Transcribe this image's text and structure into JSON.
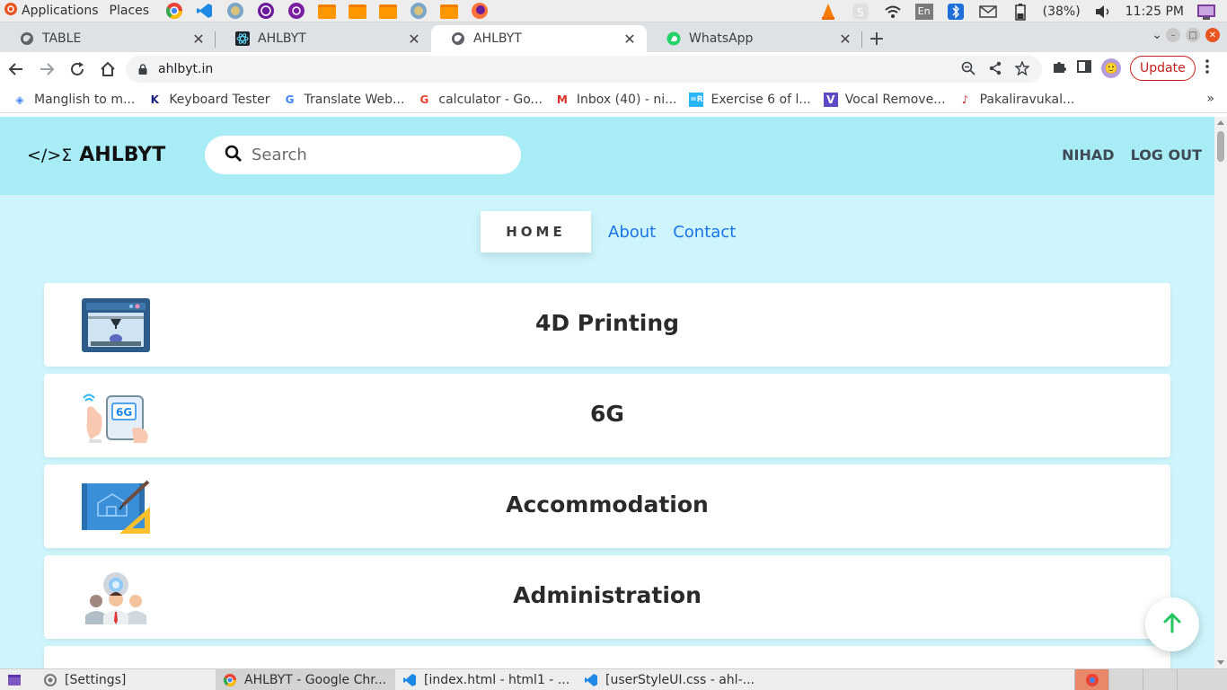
{
  "system_panel": {
    "applications_label": "Applications",
    "places_label": "Places",
    "battery_label": "(38%)",
    "clock": "11:25 PM",
    "keyboard_layout": "En"
  },
  "tabs": [
    {
      "label": "TABLE",
      "icon": "globe-icon"
    },
    {
      "label": "AHLBYT",
      "icon": "react-icon"
    },
    {
      "label": "AHLBYT",
      "icon": "globe-icon",
      "active": true
    },
    {
      "label": "WhatsApp",
      "icon": "whatsapp-icon"
    }
  ],
  "address": {
    "url": "ahlbyt.in",
    "update_label": "Update"
  },
  "bookmarks": [
    {
      "label": "Manglish to m...",
      "icon": "manglish-icon"
    },
    {
      "label": "Keyboard Tester",
      "icon": "keyboard-k-icon"
    },
    {
      "label": "Translate Web...",
      "icon": "translate-icon"
    },
    {
      "label": "calculator - Go...",
      "icon": "google-icon"
    },
    {
      "label": "Inbox (40) - ni...",
      "icon": "gmail-icon"
    },
    {
      "label": "Exercise 6 of l...",
      "icon": "exercise-icon"
    },
    {
      "label": "Vocal Remove...",
      "icon": "vocal-remover-icon"
    },
    {
      "label": "Pakaliravukal...",
      "icon": "guitar-icon"
    }
  ],
  "site": {
    "brand_symbol": "</>Σ",
    "brand_name": "AHLBYT",
    "search_placeholder": "Search",
    "user_name": "NIHAD",
    "logout_label": "LOG OUT",
    "nav": {
      "home": "HOME",
      "about": "About",
      "contact": "Contact"
    },
    "categories": [
      {
        "title": "4D Printing",
        "icon": "3d-printer-icon"
      },
      {
        "title": "6G",
        "icon": "6g-tablet-icon"
      },
      {
        "title": "Accommodation",
        "icon": "blueprint-icon"
      },
      {
        "title": "Administration",
        "icon": "team-gear-icon"
      }
    ]
  },
  "taskbar": [
    {
      "label": "[Settings]",
      "icon": "settings-icon"
    },
    {
      "label": "AHLBYT - Google Chr...",
      "icon": "chrome-icon",
      "active": true
    },
    {
      "label": "[index.html - html1 - ...",
      "icon": "vscode-icon"
    },
    {
      "label": "[userStyleUI.css - ahl-...",
      "icon": "vscode-icon"
    }
  ],
  "colors": {
    "header_bg": "#a8ecf5",
    "page_bg": "#cdf5fb",
    "link": "#1a73e8",
    "fab_arrow": "#22c55e",
    "update_red": "#c5221f"
  }
}
